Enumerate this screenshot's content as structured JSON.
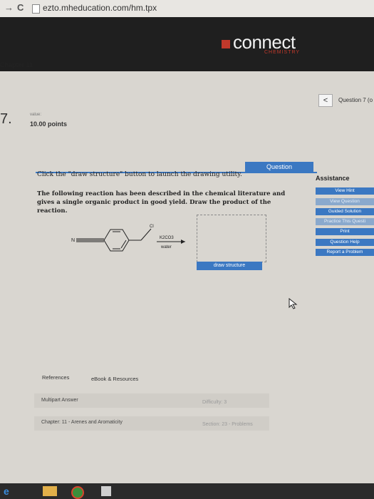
{
  "browser": {
    "back": "→",
    "reload": "C",
    "url": "ezto.mheducation.com/hm.tpx"
  },
  "brand": {
    "name": "connect",
    "subtitle": "CHEMISTRY"
  },
  "chapter_header": "Chapter 11",
  "question_nav": {
    "prev": "<",
    "label": "Question 7 (o"
  },
  "question": {
    "number": "7.",
    "value_label": "value:",
    "points": "10.00 points",
    "tab": "Question",
    "instruction": "Click the \"draw structure\" button to launch the drawing utility.",
    "prompt": "The following reaction has been described in the chemical literature and gives a single organic product in good yield. Draw the product of the reaction.",
    "reagents": {
      "above": "K2CO3",
      "below": "water",
      "substituent": "Cl",
      "nitrile": "N"
    },
    "draw_button": "draw structure"
  },
  "assistance": {
    "title": "Assistance",
    "buttons": [
      {
        "label": "View Hint",
        "enabled": true
      },
      {
        "label": "View Question",
        "enabled": false
      },
      {
        "label": "Guided Solution",
        "enabled": true
      },
      {
        "label": "Practice This Questi",
        "enabled": false
      },
      {
        "label": "Print",
        "enabled": true
      },
      {
        "label": "Question Help",
        "enabled": true
      },
      {
        "label": "Report a Problem",
        "enabled": true
      }
    ]
  },
  "footer": {
    "references": "References",
    "ebook": "eBook & Resources",
    "answer_type": "Multipart Answer",
    "difficulty": "Difficulty: 3",
    "chapter": "Chapter: 11 - Arenes and Aromaticity",
    "section": "Section: 23 - Problems"
  },
  "colors": {
    "accent": "#3b78c2",
    "brand_red": "#c0392b",
    "header_bg": "#1f1f1f"
  }
}
